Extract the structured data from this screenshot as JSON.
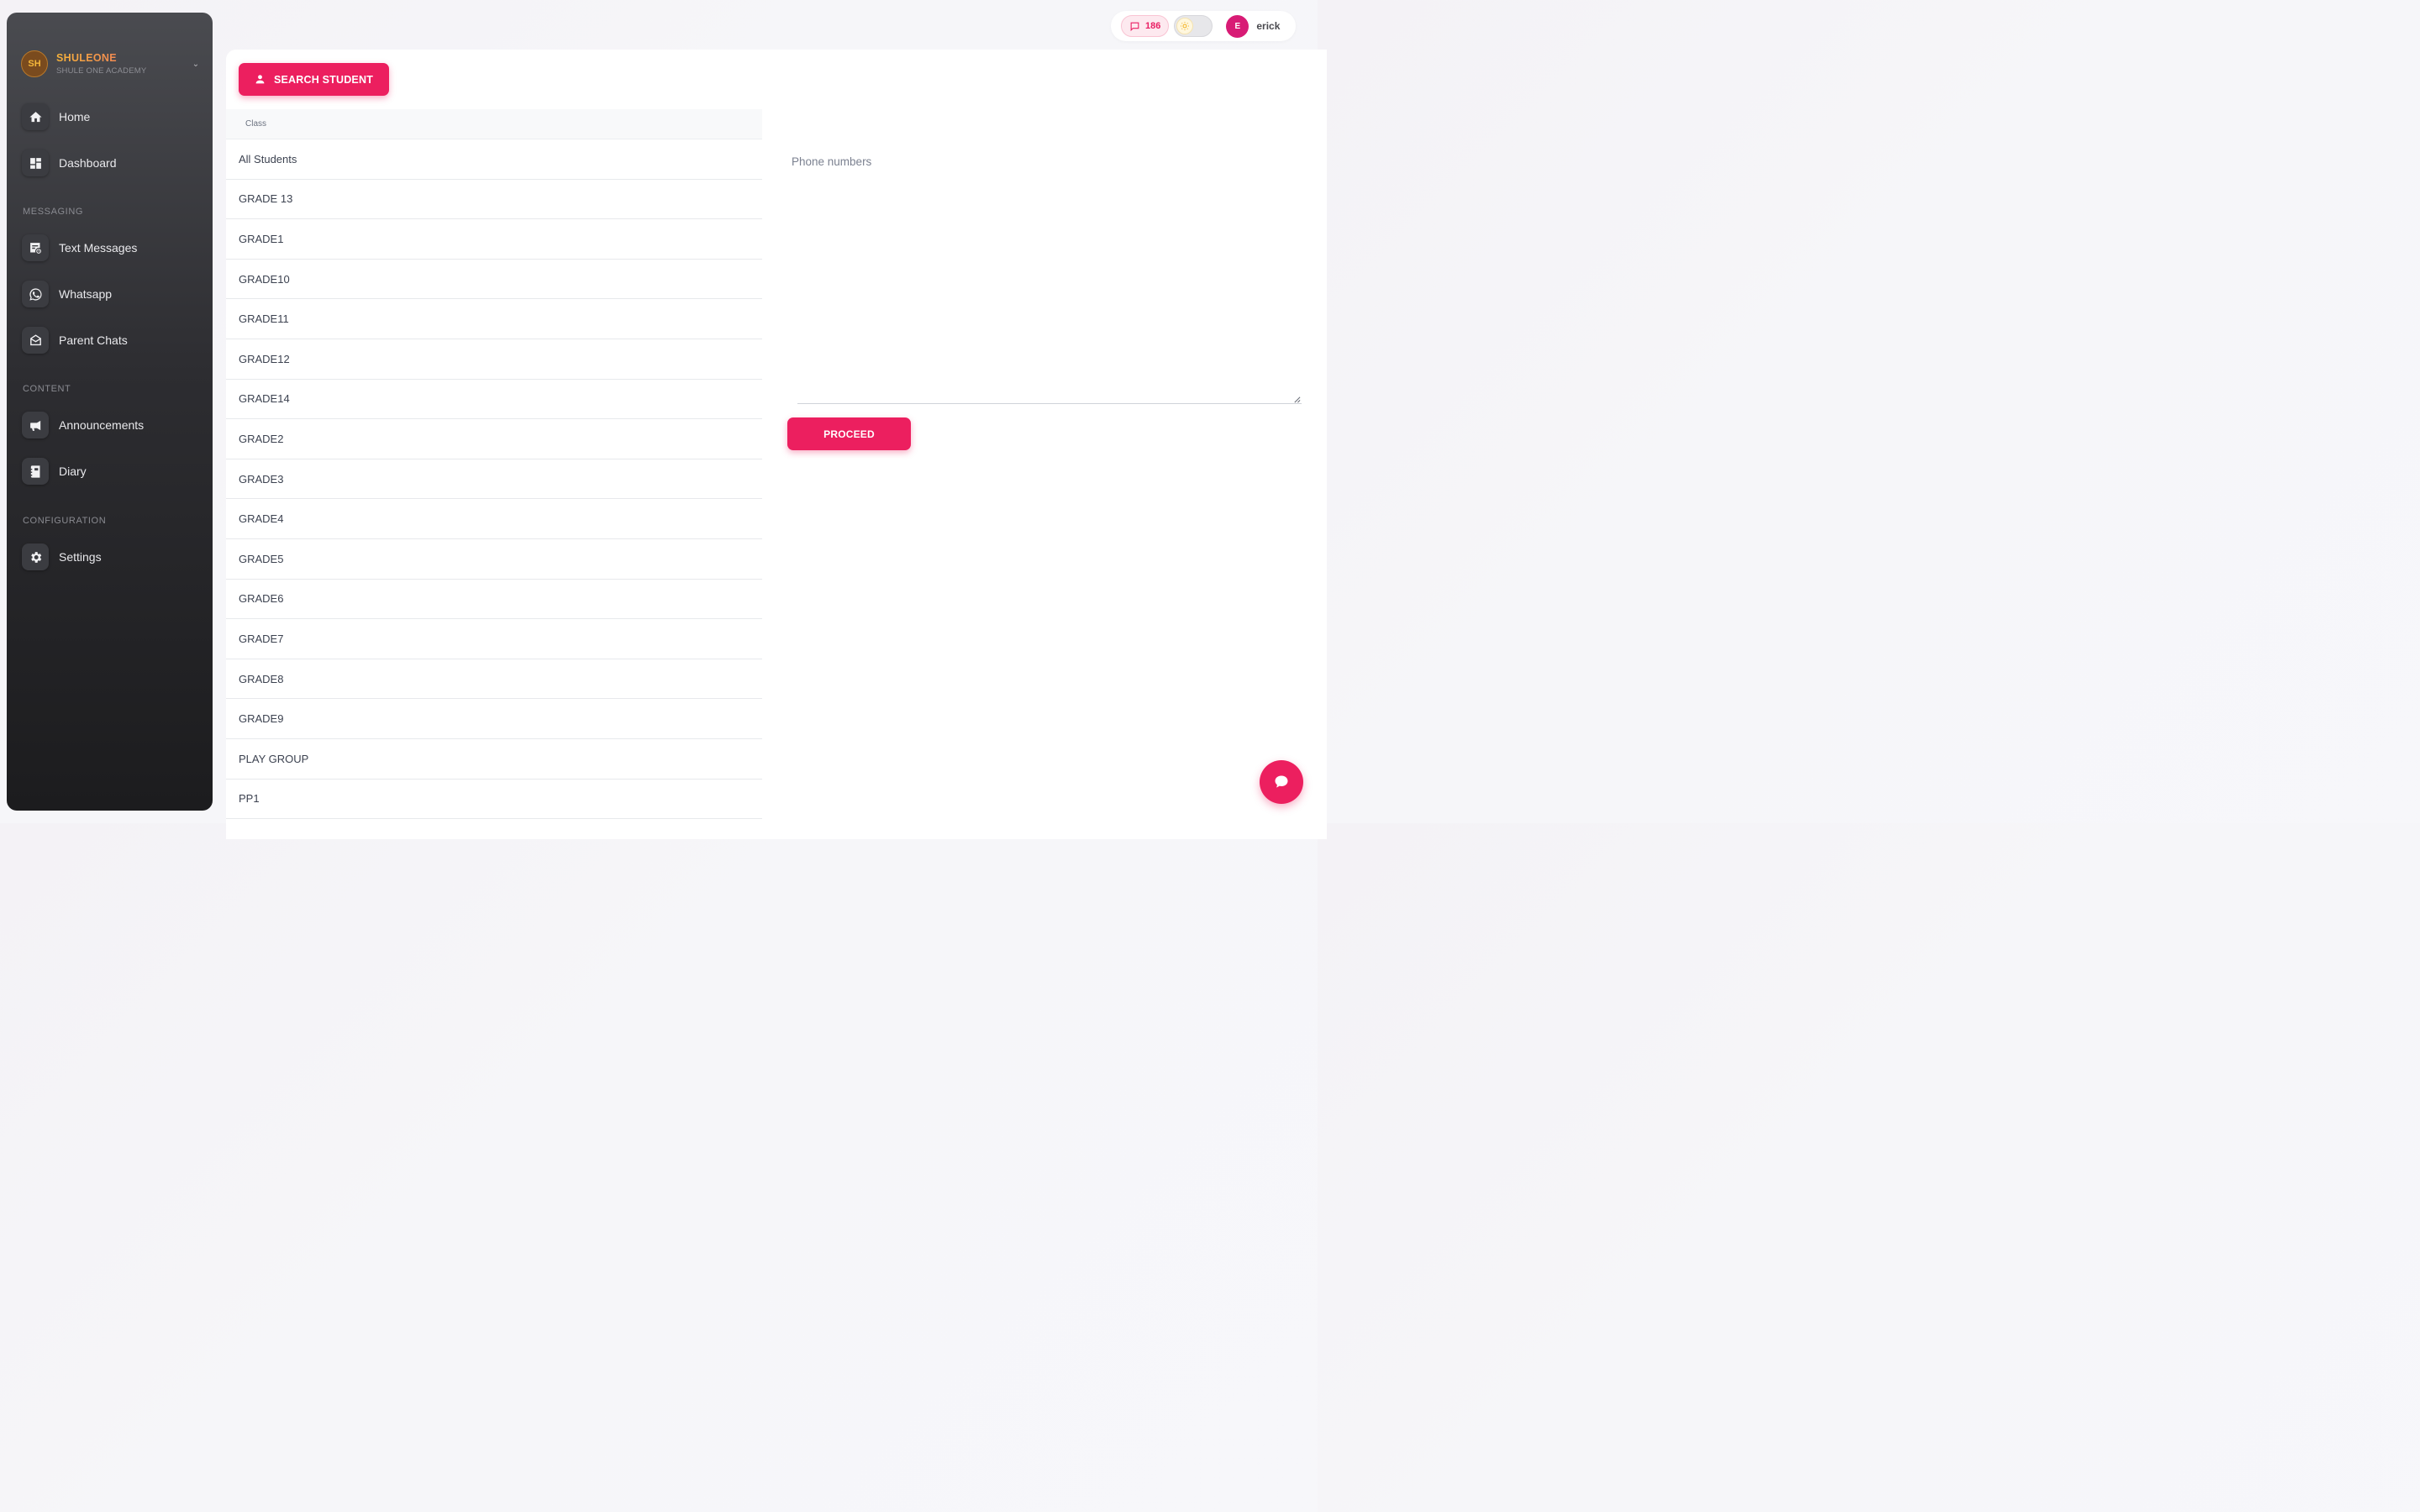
{
  "brand": {
    "logo": "SH",
    "name": "SHULEONE",
    "subtitle": "SHULE ONE ACADEMY"
  },
  "sidebar": {
    "items": [
      {
        "label": "Home",
        "icon": "home-icon"
      },
      {
        "label": "Dashboard",
        "icon": "dashboard-icon"
      },
      {
        "label": "Text Messages",
        "icon": "text-message-schedule-icon"
      },
      {
        "label": "Whatsapp",
        "icon": "whatsapp-icon"
      },
      {
        "label": "Parent Chats",
        "icon": "envelope-open-icon"
      },
      {
        "label": "Announcements",
        "icon": "megaphone-icon"
      },
      {
        "label": "Diary",
        "icon": "diary-icon"
      },
      {
        "label": "Settings",
        "icon": "gear-icon"
      }
    ],
    "sections": {
      "messaging": "MESSAGING",
      "content": "CONTENT",
      "configuration": "CONFIGURATION"
    }
  },
  "topbar": {
    "message_count": "186",
    "avatar_initial": "E",
    "username": "erick"
  },
  "main": {
    "search_button": "SEARCH STUDENT",
    "class_header": "Class",
    "classes": [
      "All Students",
      "GRADE 13",
      "GRADE1",
      "GRADE10",
      "GRADE11",
      "GRADE12",
      "GRADE14",
      "GRADE2",
      "GRADE3",
      "GRADE4",
      "GRADE5",
      "GRADE6",
      "GRADE7",
      "GRADE8",
      "GRADE9",
      "PLAY GROUP",
      "PP1"
    ],
    "phone_label": "Phone numbers",
    "phone_value": "",
    "proceed_button": "PROCEED"
  },
  "colors": {
    "accent": "#ec1f5f",
    "sidebar_top": "#4a4b50",
    "sidebar_bottom": "#1c1c1e"
  }
}
